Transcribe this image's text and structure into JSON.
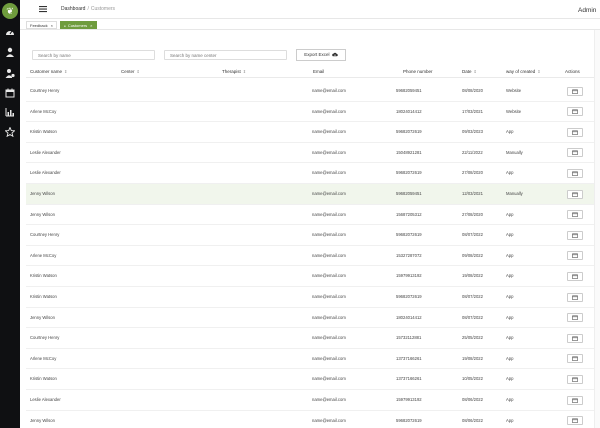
{
  "sidebar": {
    "logo_glyph": "❦",
    "icons": [
      "dashboard-icon",
      "user-icon",
      "user-settings-icon",
      "calendar-icon",
      "bar-chart-icon",
      "star-icon"
    ]
  },
  "header": {
    "menu_icon": "menu-icon",
    "breadcrumb": {
      "home": "Dashboard",
      "separator": "/",
      "current": "Customers"
    },
    "user": "Admin",
    "user_caret": "▼"
  },
  "tabs": [
    {
      "label": "Feedback",
      "close": "×"
    },
    {
      "label": "Customers",
      "close": "×",
      "dot": "●"
    }
  ],
  "filters": {
    "search_name_placeholder": "Search by name",
    "search_center_placeholder": "Search by name center",
    "export_label": "Export Excel",
    "export_icon": "cloud-download-icon"
  },
  "table": {
    "sort_glyph": "⇕",
    "columns": {
      "name": "Customer name",
      "center": "Center",
      "therapist": "Therapist",
      "email": "Email",
      "phone": "Phone number",
      "date": "Date",
      "way": "way of created",
      "actions": "Actions"
    },
    "rows": [
      {
        "name": "Courtney Henry",
        "email": "name@email.com",
        "phone": "59682059451",
        "date": "08/08/2020",
        "way": "Website"
      },
      {
        "name": "Arlene McCoy",
        "email": "name@email.com",
        "phone": "18024014412",
        "date": "17/03/2021",
        "way": "Website"
      },
      {
        "name": "Kristin Watson",
        "email": "name@email.com",
        "phone": "59682072619",
        "date": "09/03/2023",
        "way": "App"
      },
      {
        "name": "Leslie Alexander",
        "email": "name@email.com",
        "phone": "15048921281",
        "date": "22/11/2022",
        "way": "Manually"
      },
      {
        "name": "Leslie Alexander",
        "email": "name@email.com",
        "phone": "59682072619",
        "date": "27/08/2020",
        "way": "App"
      },
      {
        "name": "Jenny Wilson",
        "email": "name@email.com",
        "phone": "59682059451",
        "date": "12/03/2021",
        "way": "Manually",
        "highlight": true
      },
      {
        "name": "Jenny Wilson",
        "email": "name@email.com",
        "phone": "15687205312",
        "date": "27/08/2020",
        "way": "App"
      },
      {
        "name": "Courtney Henry",
        "email": "name@email.com",
        "phone": "59682072619",
        "date": "08/07/2022",
        "way": "App"
      },
      {
        "name": "Arlene McCoy",
        "email": "name@email.com",
        "phone": "15327287072",
        "date": "09/08/2022",
        "way": "App"
      },
      {
        "name": "Kristin Watson",
        "email": "name@email.com",
        "phone": "15979913192",
        "date": "19/08/2022",
        "way": "App"
      },
      {
        "name": "Kristin Watson",
        "email": "name@email.com",
        "phone": "59682072619",
        "date": "08/07/2022",
        "way": "App"
      },
      {
        "name": "Jenny Wilson",
        "email": "name@email.com",
        "phone": "18024014412",
        "date": "08/07/2022",
        "way": "App"
      },
      {
        "name": "Courtney Henry",
        "email": "name@email.com",
        "phone": "15732112881",
        "date": "25/05/2022",
        "way": "App"
      },
      {
        "name": "Arlene McCoy",
        "email": "name@email.com",
        "phone": "13737166261",
        "date": "19/08/2022",
        "way": "App"
      },
      {
        "name": "Kristin Watson",
        "email": "name@email.com",
        "phone": "13737166261",
        "date": "10/05/2022",
        "way": "App"
      },
      {
        "name": "Leslie Alexander",
        "email": "name@email.com",
        "phone": "15979913192",
        "date": "08/06/2022",
        "way": "App"
      },
      {
        "name": "Jenny Wilson",
        "email": "name@email.com",
        "phone": "59682072619",
        "date": "08/06/2022",
        "way": "App"
      }
    ]
  },
  "colors": {
    "accent": "#6f9c3d",
    "sidebar_bg": "#0f1012",
    "row_highlight": "#f1f6ec"
  }
}
